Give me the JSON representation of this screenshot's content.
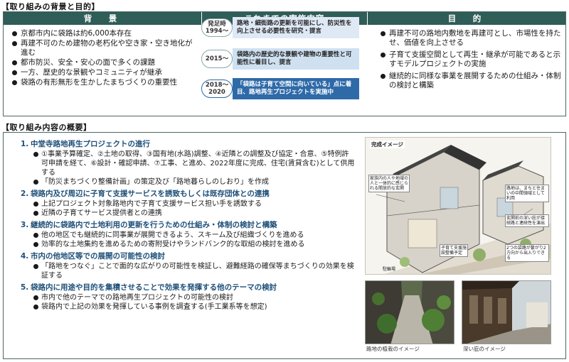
{
  "background_section": {
    "title": "【取り組みの背景と目的】",
    "col_background": {
      "heading": "背　景",
      "bullets": [
        "京都市内に袋路は約6,000本存在",
        "再建不可のため建物の老朽化や空き家・空き地化が進む",
        "都市防災、安全・安心の面で多くの課題",
        "一方、歴史的な景観やコミュニティが継承",
        "袋路の有形無形を生かしたまちづくりの重要性"
      ]
    },
    "col_history": {
      "heading": "これまでの実施内容",
      "items": [
        {
          "year": "発足時 1994～",
          "text": "路地・細街路の更新を可能にし、防災性を向上させる必要性を研究・提言"
        },
        {
          "year": "2015～",
          "text": "袋路内の歴史的な景観や建物の重要性と可能性に着目し、提言"
        },
        {
          "year": "2018～ 2020",
          "text": "「袋路は子育て空間に向いている」点に着目、路地再生プロジェクトを実施中"
        }
      ]
    },
    "col_purpose": {
      "heading": "目　的",
      "bullets": [
        "再建不可の路地内敷地を再建可とし、市場性を持たせ、価値を向上させる",
        "子育て支援空間として再生・継承が可能であると示すモデルプロジェクトの実施",
        "継続的に同様な事業を展開するための仕組み・体制の検討と構築"
      ]
    }
  },
  "overview_section": {
    "title": "【取り組み内容の概要】",
    "items": [
      {
        "num": "1.",
        "heading": "中堂寺路地再生プロジェクトの進行",
        "subs": [
          "①事業予算確定、②土地の取得、③国有地(水路)調整、④近隣との調整及び協定・合意、⑤特例許可申請を経て、⑥設計・確認申請、⑦工事、と進め、2022年度に完成、住宅(賃貸含む)として供用する",
          "「防災まちづくり整備計画」の策定及び「路地暮らしのしおり」を作成"
        ]
      },
      {
        "num": "2.",
        "heading": "袋路内及び周辺に子育て支援サービスを誘致もしくは既存団体との連携",
        "subs": [
          "上記プロジェクト対象路地内で子育て支援サービス担い手を誘致する",
          "近隣の子育てサービス提供者との連携"
        ]
      },
      {
        "num": "3.",
        "heading": "継続的に袋路内で土地利用の更新を行うための仕組み・体制の検討と構築",
        "subs": [
          "他の地区でも継続的に同事業が展開できるよう、スキーム及び組織づくりを進める",
          "効率的な土地集約を進めるための寄附受けやランドバンク的な取組の検討を進める"
        ]
      },
      {
        "num": "4.",
        "heading": "市内の他地区等での展開の可能性の検討",
        "subs": [
          "「路地をつなぐ」ことで面的な広がりの可能性を検証し、避難経路の確保等まちづくりの効果を検証する"
        ]
      },
      {
        "num": "5.",
        "heading": "袋路内に用途や目的を集積させることで効果を発揮する他のテーマの検討",
        "subs": [
          "市内で他のテーマでの路地再生プロジェクトの可能性の検討",
          "袋路内で上記の効果を発揮している事例を調査する(手工業系等を想定)"
        ]
      }
    ],
    "illustration": {
      "title": "完成イメージ",
      "callouts": [
        "家族内の人や地域の人と一体的に感じられる開放的な玄関",
        "路地は、まちと住まいの中間領域として利用",
        "玄関前の深い庇が接続路と連続性を演出",
        "子育て支援施設整備予定",
        "2つの袋路が繋がり2方向から出入りできる",
        "駐輪場"
      ]
    },
    "photos": [
      {
        "caption": "路地の植栽のイメージ"
      },
      {
        "caption": "深い庇のイメージ"
      }
    ]
  }
}
